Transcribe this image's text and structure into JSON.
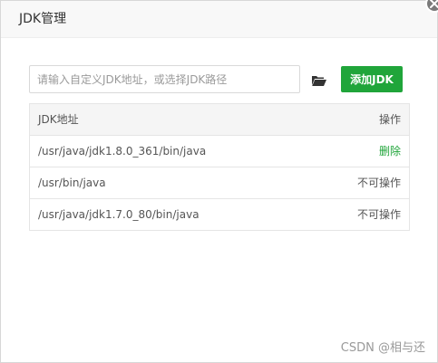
{
  "dialog": {
    "title": "JDK管理"
  },
  "toolbar": {
    "input_placeholder": "请输入自定义JDK地址，或选择JDK路径",
    "input_value": "",
    "folder_icon": "folder-open-icon",
    "add_button_label": "添加JDK",
    "accent_color": "#20a53a"
  },
  "table": {
    "headers": {
      "path": "JDK地址",
      "action": "操作"
    },
    "rows": [
      {
        "path": "/usr/java/jdk1.8.0_361/bin/java",
        "action": "删除"
      },
      {
        "path": "/usr/bin/java",
        "action": "不可操作"
      },
      {
        "path": "/usr/java/jdk1.7.0_80/bin/java",
        "action": "不可操作"
      }
    ]
  },
  "watermark": "CSDN @相与还"
}
